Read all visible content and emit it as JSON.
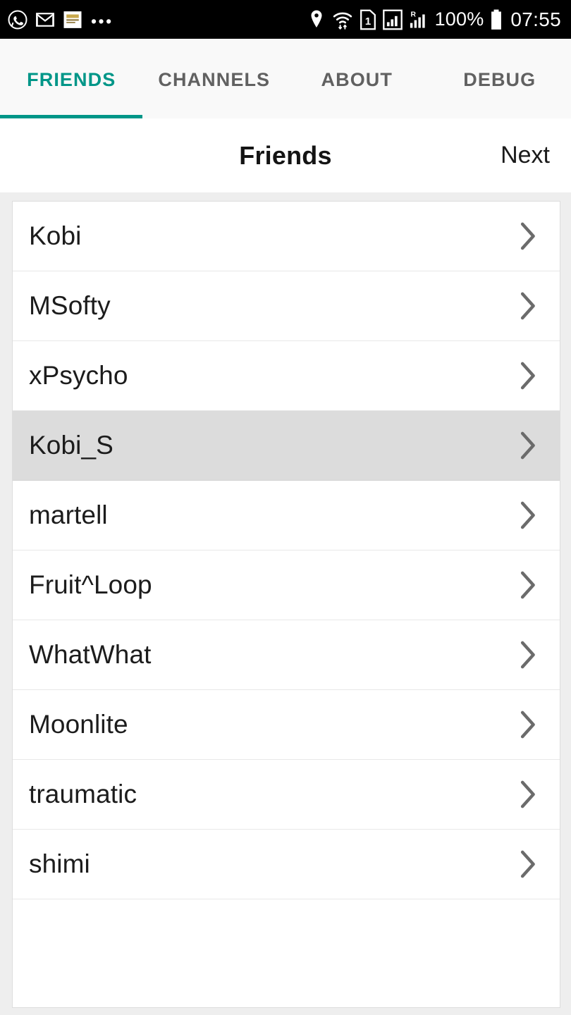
{
  "status_bar": {
    "left_icons": [
      "whatsapp-icon",
      "gmail-icon",
      "news-app-icon"
    ],
    "overflow_indicator": "•••",
    "right_icons": [
      "location-pin-icon",
      "wifi-icon",
      "sim-1-icon",
      "signal-bars-icon",
      "roaming-signal-icon",
      "battery-icon"
    ],
    "battery_percent": "100%",
    "time": "07:55"
  },
  "tabs": [
    {
      "label": "FRIENDS",
      "active": true
    },
    {
      "label": "CHANNELS",
      "active": false
    },
    {
      "label": "ABOUT",
      "active": false
    },
    {
      "label": "DEBUG",
      "active": false
    }
  ],
  "header": {
    "title": "Friends",
    "action_label": "Next"
  },
  "friends": [
    {
      "name": "Kobi",
      "selected": false
    },
    {
      "name": "MSofty",
      "selected": false
    },
    {
      "name": "xPsycho",
      "selected": false
    },
    {
      "name": "Kobi_S",
      "selected": true
    },
    {
      "name": "martell",
      "selected": false
    },
    {
      "name": "Fruit^Loop",
      "selected": false
    },
    {
      "name": "WhatWhat",
      "selected": false
    },
    {
      "name": "Moonlite",
      "selected": false
    },
    {
      "name": "traumatic",
      "selected": false
    },
    {
      "name": "shimi",
      "selected": false
    }
  ],
  "colors": {
    "accent_teal": "#009688",
    "status_bar_bg": "#000000",
    "tab_bar_bg": "#f9f9f9",
    "page_bg": "#eeeeee",
    "card_bg": "#ffffff",
    "selected_row_bg": "#dcdcdc",
    "inactive_tab_text": "#616161"
  }
}
